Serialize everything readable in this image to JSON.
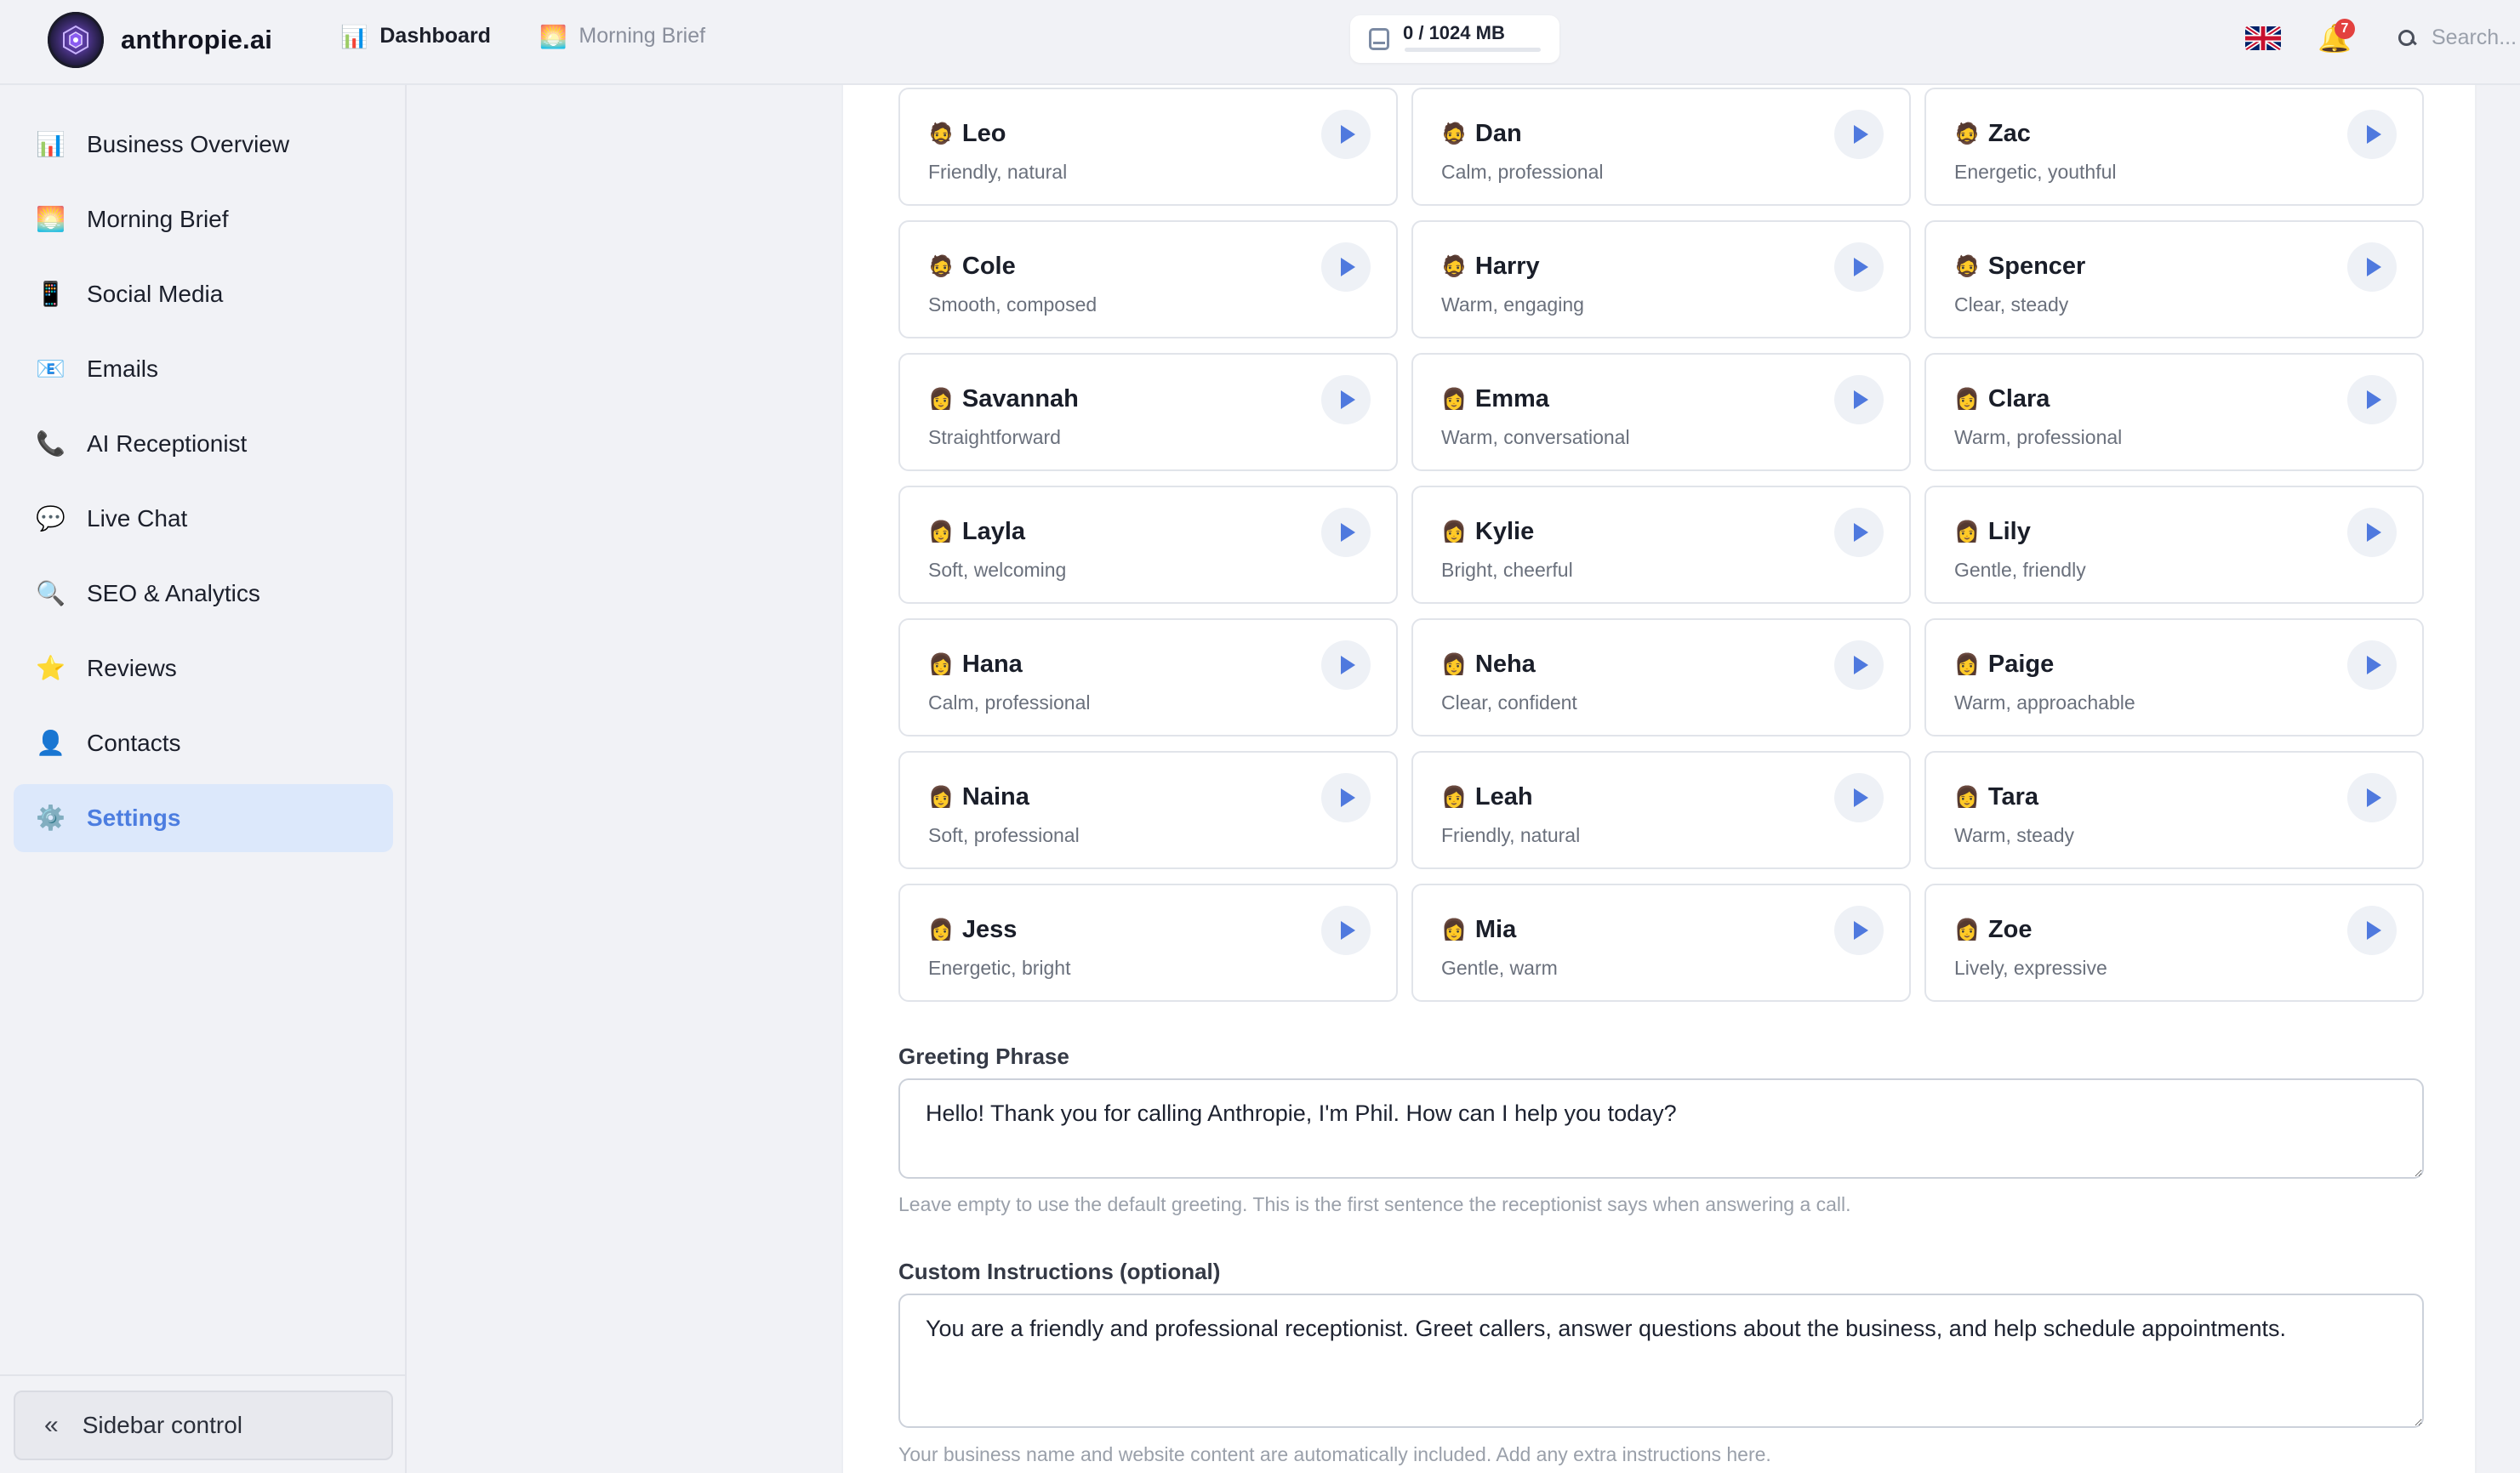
{
  "app": {
    "brand": "anthropie.ai",
    "nav": [
      {
        "label": "Dashboard",
        "icon": "bar-chart-icon"
      },
      {
        "label": "Morning Brief",
        "icon": "sunrise-icon"
      }
    ],
    "storage": {
      "text": "0 / 1024 MB",
      "used_fraction": 0.0
    },
    "language": "uk-flag-icon",
    "notifications": {
      "count": "7"
    },
    "search": {
      "placeholder": "Search..."
    }
  },
  "sidebar": {
    "items": [
      {
        "label": "Business Overview",
        "icon": "📊"
      },
      {
        "label": "Morning Brief",
        "icon": "🌅"
      },
      {
        "label": "Social Media",
        "icon": "📱"
      },
      {
        "label": "Emails",
        "icon": "📧"
      },
      {
        "label": "AI Receptionist",
        "icon": "📞"
      },
      {
        "label": "Live Chat",
        "icon": "💬"
      },
      {
        "label": "SEO & Analytics",
        "icon": "🔍"
      },
      {
        "label": "Reviews",
        "icon": "⭐"
      },
      {
        "label": "Contacts",
        "icon": "👤"
      },
      {
        "label": "Settings",
        "icon": "⚙️"
      }
    ],
    "active": "Settings",
    "control": {
      "label": "Sidebar control",
      "chevron": "«"
    }
  },
  "voices": [
    {
      "name": "Leo",
      "desc": "Friendly, natural",
      "emoji": "🧔"
    },
    {
      "name": "Dan",
      "desc": "Calm, professional",
      "emoji": "🧔"
    },
    {
      "name": "Zac",
      "desc": "Energetic, youthful",
      "emoji": "🧔"
    },
    {
      "name": "Cole",
      "desc": "Smooth, composed",
      "emoji": "🧔"
    },
    {
      "name": "Harry",
      "desc": "Warm, engaging",
      "emoji": "🧔"
    },
    {
      "name": "Spencer",
      "desc": "Clear, steady",
      "emoji": "🧔"
    },
    {
      "name": "Savannah",
      "desc": "Straightforward",
      "emoji": "👩"
    },
    {
      "name": "Emma",
      "desc": "Warm, conversational",
      "emoji": "👩"
    },
    {
      "name": "Clara",
      "desc": "Warm, professional",
      "emoji": "👩"
    },
    {
      "name": "Layla",
      "desc": "Soft, welcoming",
      "emoji": "👩"
    },
    {
      "name": "Kylie",
      "desc": "Bright, cheerful",
      "emoji": "👩"
    },
    {
      "name": "Lily",
      "desc": "Gentle, friendly",
      "emoji": "👩"
    },
    {
      "name": "Hana",
      "desc": "Calm, professional",
      "emoji": "👩"
    },
    {
      "name": "Neha",
      "desc": "Clear, confident",
      "emoji": "👩"
    },
    {
      "name": "Paige",
      "desc": "Warm, approachable",
      "emoji": "👩"
    },
    {
      "name": "Naina",
      "desc": "Soft, professional",
      "emoji": "👩"
    },
    {
      "name": "Leah",
      "desc": "Friendly, natural",
      "emoji": "👩"
    },
    {
      "name": "Tara",
      "desc": "Warm, steady",
      "emoji": "👩"
    },
    {
      "name": "Jess",
      "desc": "Energetic, bright",
      "emoji": "👩"
    },
    {
      "name": "Mia",
      "desc": "Gentle, warm",
      "emoji": "👩"
    },
    {
      "name": "Zoe",
      "desc": "Lively, expressive",
      "emoji": "👩"
    }
  ],
  "greeting": {
    "label": "Greeting Phrase",
    "value": "Hello! Thank you for calling Anthropie, I'm Phil. How can I help you today?",
    "help": "Leave empty to use the default greeting. This is the first sentence the receptionist says when answering a call."
  },
  "instructions": {
    "label": "Custom Instructions (optional)",
    "value": "You are a friendly and professional receptionist. Greet callers, answer questions about the business, and help schedule appointments.",
    "help": "Your business name and website content are automatically included. Add any extra instructions here."
  },
  "colors": {
    "accent": "#4c7de0",
    "active_bg": "#dce8fb",
    "badge": "#e3413f"
  }
}
